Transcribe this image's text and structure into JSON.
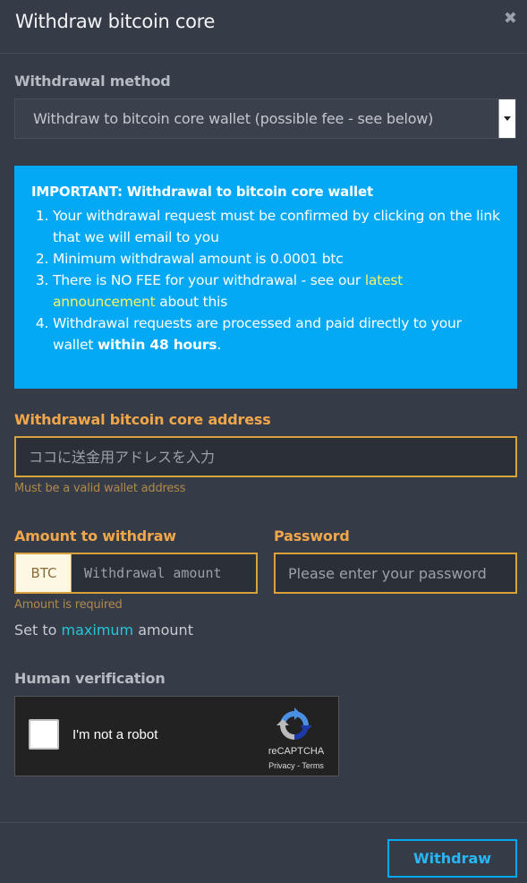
{
  "modal": {
    "title": "Withdraw bitcoin core",
    "close_icon": "close-icon"
  },
  "method": {
    "label": "Withdrawal method",
    "selected": "Withdraw to bitcoin core wallet (possible fee - see below)"
  },
  "notice": {
    "title": "IMPORTANT: Withdrawal to bitcoin core wallet",
    "item1": "Your withdrawal request must be confirmed by clicking on the link that we will email to you",
    "item2": "Minimum withdrawal amount is 0.0001 btc",
    "item3_pre": "There is NO FEE for your withdrawal - see our ",
    "item3_link": "latest announcement",
    "item3_post": " about this",
    "item4_pre": "Withdrawal requests are processed and paid directly to your wallet ",
    "item4_bold": "within 48 hours",
    "item4_post": ".",
    "background": "#03a9f4",
    "link_color": "#f7f466"
  },
  "address": {
    "label": "Withdrawal bitcoin core address",
    "placeholder": "ココに送金用アドレスを入力",
    "hint": "Must be a valid wallet address"
  },
  "amount": {
    "label": "Amount to withdraw",
    "currency": "BTC",
    "placeholder": "Withdrawal amount",
    "hint": "Amount is required"
  },
  "password": {
    "label": "Password",
    "placeholder": "Please enter your password"
  },
  "set_max": {
    "pre": "Set to ",
    "link": "maximum",
    "post": " amount"
  },
  "verification": {
    "label": "Human verification",
    "checkbox_label": "I'm not a robot",
    "brand": "reCAPTCHA",
    "privacy": "Privacy",
    "separator": " - ",
    "terms": "Terms",
    "logo_icon": "recaptcha-logo-icon"
  },
  "footer": {
    "withdraw_label": "Withdraw"
  },
  "colors": {
    "background": "#363c47",
    "accent_orange": "#f0a64a",
    "input_border": "#d7a33a",
    "button_blue": "#03a9f4",
    "link_teal": "#26c6da"
  }
}
